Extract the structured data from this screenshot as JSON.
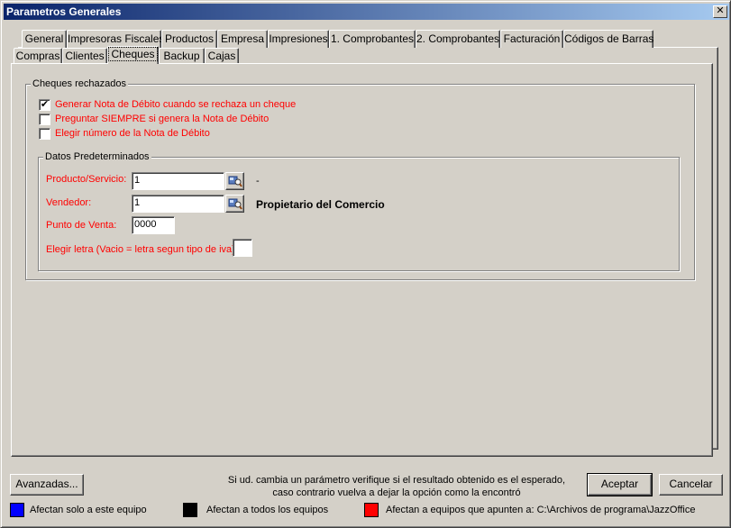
{
  "window": {
    "title": "Parametros Generales",
    "close_label": "✕"
  },
  "tabs_row1": [
    {
      "label": "General"
    },
    {
      "label": "Impresoras Fiscales"
    },
    {
      "label": "Productos"
    },
    {
      "label": "Empresa"
    },
    {
      "label": "Impresiones"
    },
    {
      "label": "1. Comprobantes"
    },
    {
      "label": "2. Comprobantes"
    },
    {
      "label": "Facturación"
    },
    {
      "label": "Códigos de Barras"
    }
  ],
  "tabs_row2": [
    {
      "label": "Compras"
    },
    {
      "label": "Clientes"
    },
    {
      "label": "Cheques",
      "active": true
    },
    {
      "label": "Backup"
    },
    {
      "label": "Cajas"
    }
  ],
  "cheques_group": {
    "title": "Cheques rechazados",
    "options": [
      {
        "label": "Generar Nota de Débito cuando se rechaza un cheque",
        "checked": true
      },
      {
        "label": "Preguntar SIEMPRE si genera la Nota de Débito",
        "checked": false
      },
      {
        "label": "Elegir número de la Nota de Débito",
        "checked": false
      }
    ]
  },
  "defaults_group": {
    "title": "Datos Predeterminados",
    "producto_label": "Producto/Servicio:",
    "producto_value": "1",
    "producto_desc": "-",
    "vendedor_label": "Vendedor:",
    "vendedor_value": "1",
    "vendedor_desc": "Propietario del Comercio",
    "punto_label": "Punto de Venta:",
    "punto_value": "0000",
    "letra_label": "Elegir letra (Vacio = letra segun tipo de iva)",
    "letra_value": ""
  },
  "footer": {
    "advanced_label": "Avanzadas...",
    "info_line1": "Si ud. cambia un parámetro verifique si el resultado obtenido es el esperado,",
    "info_line2": "caso contrario vuelva a dejar la opción como la encontró",
    "accept_label": "Aceptar",
    "cancel_label": "Cancelar"
  },
  "legend": [
    {
      "color": "#0000ff",
      "label": "Afectan solo a este equipo"
    },
    {
      "color": "#000000",
      "label": "Afectan a todos los equipos"
    },
    {
      "color": "#ff0000",
      "label": "Afectan a equipos que apunten a: C:\\Archivos de programa\\JazzOffice"
    }
  ],
  "colors": {
    "label_red": "#ff0000",
    "title_bar": "#0a246a"
  }
}
